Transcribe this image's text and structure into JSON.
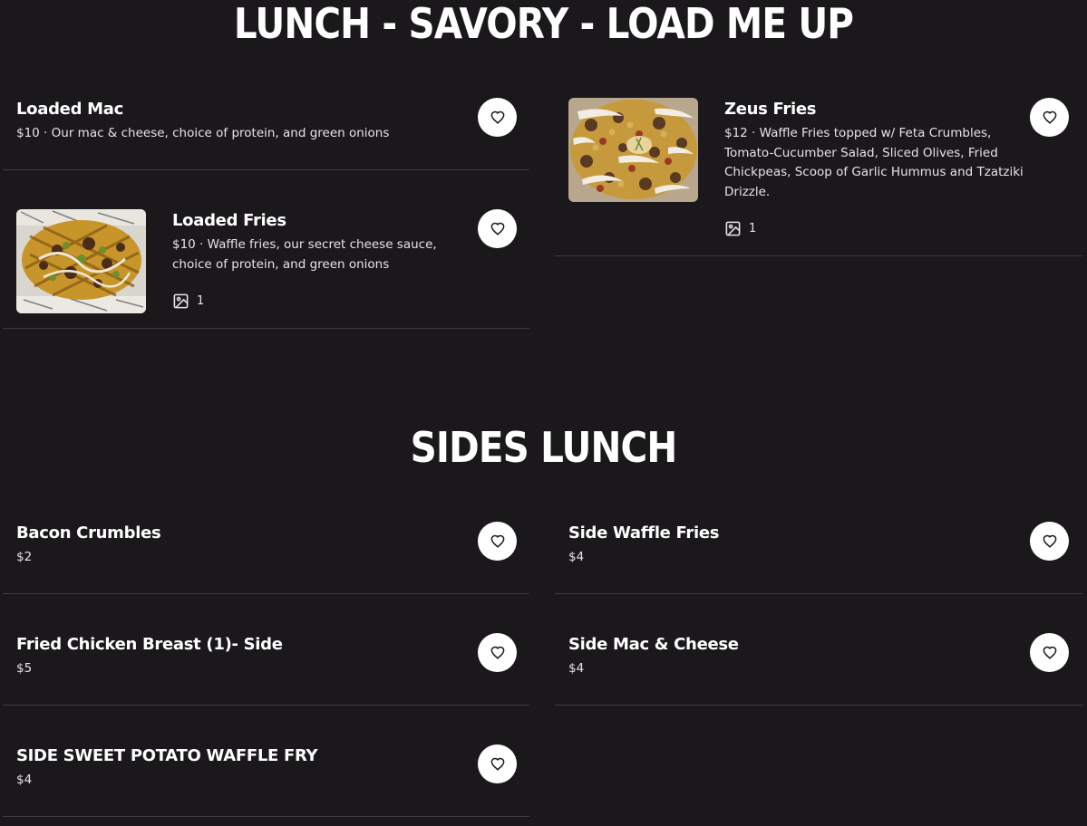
{
  "sections": [
    {
      "title": "LUNCH - SAVORY - LOAD ME UP",
      "items": [
        {
          "name": "Loaded Mac",
          "desc": "$10 · Our mac & cheese, choice of protein, and green onions"
        },
        {
          "name": "Zeus Fries",
          "desc": "$12 · Waffle Fries topped w/ Feta Crumbles, Tomato-Cucumber Salad, Sliced Olives, Fried Chickpeas, Scoop of Garlic Hummus and Tzatziki Drizzle.",
          "photo_count": "1"
        },
        {
          "name": "Loaded Fries",
          "desc": "$10 · Waffle fries, our secret cheese sauce, choice of protein, and green onions",
          "photo_count": "1"
        }
      ]
    },
    {
      "title": "SIDES LUNCH",
      "items": [
        {
          "name": "Bacon Crumbles",
          "desc": "$2"
        },
        {
          "name": "Side Waffle Fries",
          "desc": "$4"
        },
        {
          "name": "Fried Chicken Breast (1)- Side",
          "desc": "$5"
        },
        {
          "name": "Side Mac & Cheese",
          "desc": "$4"
        },
        {
          "name": "SIDE SWEET POTATO WAFFLE FRY",
          "desc": "$4"
        }
      ]
    }
  ],
  "icons": {
    "favorite": "heart-icon",
    "photos": "image-icon"
  },
  "colors": {
    "background": "#1a181b",
    "divider": "#3d3a3e",
    "text": "#ffffff",
    "button": "#ffffff"
  }
}
